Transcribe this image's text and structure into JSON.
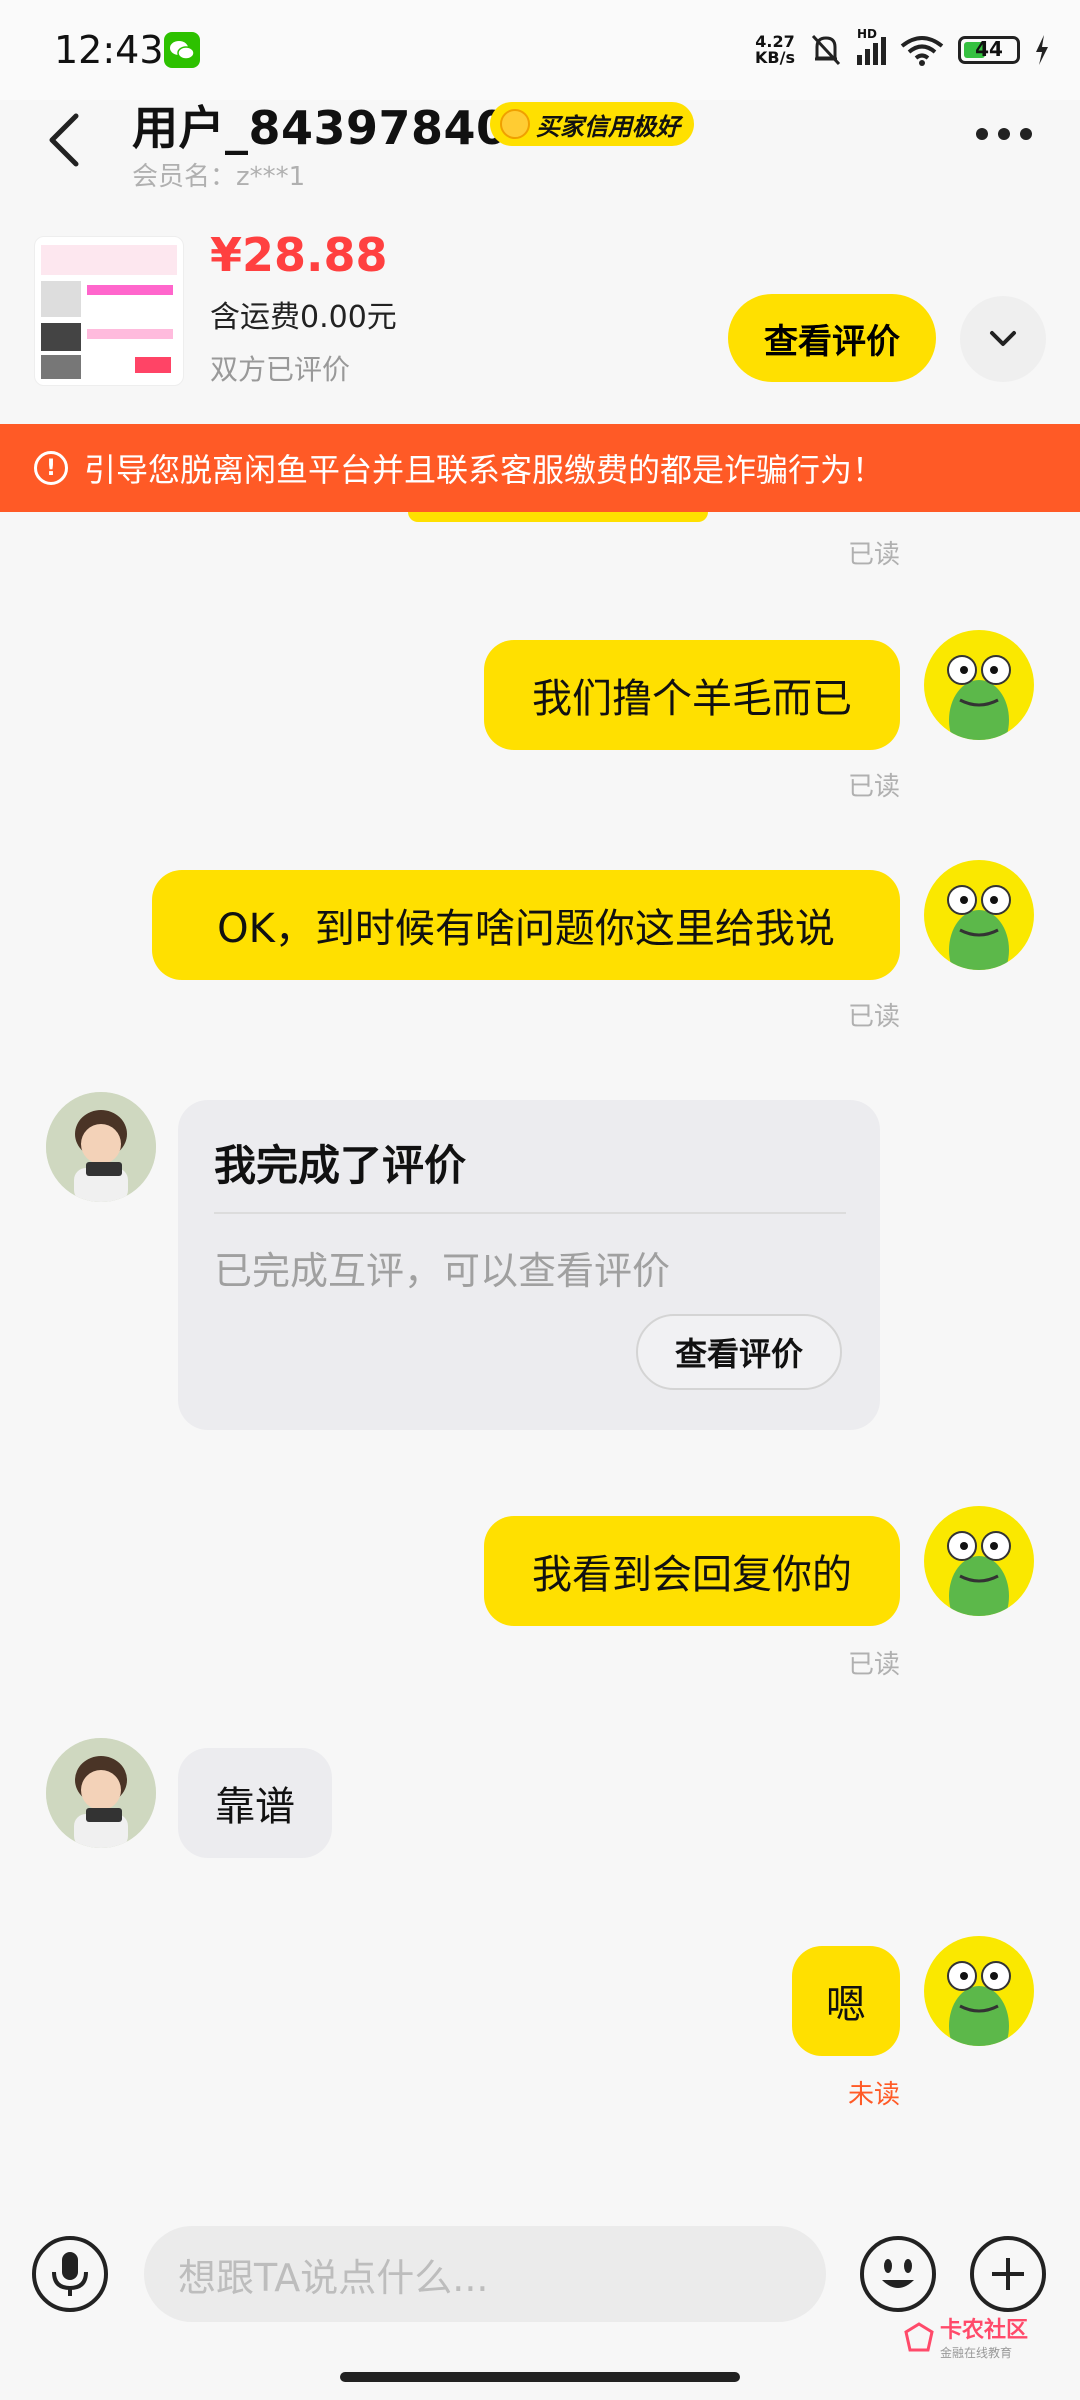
{
  "status_bar": {
    "time": "12:43",
    "net_speed_top": "4.27",
    "net_speed_bottom": "KB/s",
    "signal_tag": "HD",
    "battery": "44"
  },
  "header": {
    "title": "用户_84397840",
    "credit_badge": "买家信用极好",
    "member_name": "会员名：z***1"
  },
  "product": {
    "price": "¥28.88",
    "shipping": "含运费0.00元",
    "review_status": "双方已评价",
    "view_review_label": "查看评价"
  },
  "warning": {
    "icon": "!",
    "text": "引导您脱离闲鱼平台并且联系客服缴费的都是诈骗行为！"
  },
  "messages": {
    "read_label": "已读",
    "unread_label": "未读",
    "m1": "我们撸个羊毛而已",
    "m2": "OK，到时候有啥问题你这里给我说",
    "card": {
      "title": "我完成了评价",
      "desc": "已完成互评，可以查看评价",
      "button": "查看评价"
    },
    "m3": "我看到会回复你的",
    "m4": "靠谱",
    "m5": "嗯"
  },
  "input_bar": {
    "placeholder": "想跟TA说点什么..."
  },
  "watermark": {
    "title": "卡农社区",
    "subtitle": "金融在线教育"
  },
  "colors": {
    "accent_yellow": "#ffe000",
    "warning": "#ff5a26",
    "price": "#ff4040"
  }
}
